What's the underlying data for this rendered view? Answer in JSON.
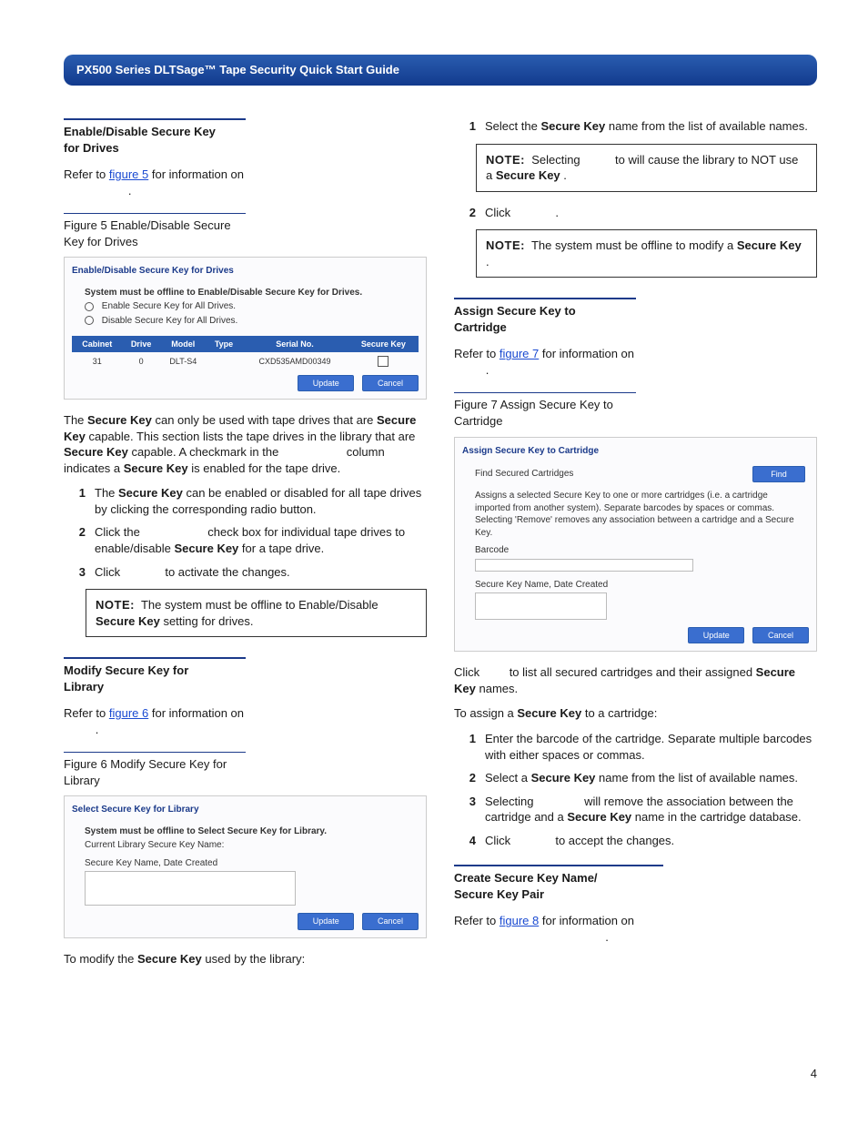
{
  "banner": "PX500 Series DLTSage™ Tape Security Quick Start Guide",
  "page_number": "4",
  "L": {
    "s1_title_a": "Enable/Disable Secure Key",
    "s1_title_b": "for Drives",
    "s1_para": "Refer to ",
    "s1_link": "figure 5",
    "s1_para2": " for information on",
    "s1_para_end": ".",
    "fig5_cap_a": "Figure 5  Enable/Disable Secure",
    "fig5_cap_b": "Key for Drives",
    "fig5": {
      "panel_title": "Enable/Disable Secure Key for Drives",
      "warn": "System must be offline to Enable/Disable Secure Key for Drives.",
      "radio1": "Enable Secure Key for All Drives.",
      "radio2": "Disable Secure Key for All Drives.",
      "th": [
        "Cabinet",
        "Drive",
        "Model",
        "Type",
        "Serial No.",
        "Secure Key"
      ],
      "row": [
        "31",
        "0",
        "DLT-S4",
        "",
        "CXD535AMD00349",
        ""
      ],
      "btn_update": "Update",
      "btn_cancel": "Cancel"
    },
    "p1a": "The ",
    "p1b": "Secure Key",
    "p1c": " can only be used with tape drives that are ",
    "p1d": "Secure Key",
    "p1e": " capable. This section lists the tape drives in the library that are ",
    "p1f": "Secure Key",
    "p1g": " capable. A checkmark in the",
    "p1h": "column indicates a ",
    "p1i": "Secure Key",
    "p1j": " is enabled for the tape drive.",
    "li1a": "The ",
    "li1b": "Secure Key",
    "li1c": " can be enabled or disabled for all tape drives by clicking the corresponding radio button.",
    "li2a": "Click the ",
    "li2b": "check box for individual tape drives to enable/disable ",
    "li2c": "Secure Key",
    "li2d": " for a tape drive.",
    "li3a": "Click ",
    "li3b": "to activate the changes.",
    "note1_l": "NOTE:",
    "note1a": "The system must be offline to Enable/Disable ",
    "note1b": "Secure Key",
    "note1c": " setting for drives.",
    "s2_title_a": "Modify Secure Key for",
    "s2_title_b": "Library",
    "s2_para": "Refer to ",
    "s2_link": "figure 6",
    "s2_para2": " for information on",
    "s2_para_end": ".",
    "fig6_cap_a": "Figure 6  Modify Secure Key for",
    "fig6_cap_b": "Library",
    "fig6": {
      "panel_title": "Select Secure Key for Library",
      "warn": "System must be offline to Select Secure Key for Library.",
      "curr": "Current Library Secure Key Name:",
      "lbl": "Secure Key Name, Date Created",
      "btn_update": "Update",
      "btn_cancel": "Cancel"
    },
    "p2a": "To modify the ",
    "p2b": "Secure Key",
    "p2c": " used by the library:"
  },
  "R": {
    "li1a": "Select the ",
    "li1b": "Secure Key",
    "li1c": " name from the list of available names.",
    "noteA_l": "NOTE:",
    "noteA_a": "Selecting ",
    "noteA_gap": "to will cause the library to NOT use a ",
    "noteA_b": "Secure Key",
    "noteA_c": ".",
    "li2a": "Click ",
    "li2b": ".",
    "noteB_l": "NOTE:",
    "noteB_a": "The system must be offline to modify a ",
    "noteB_b": "Secure Key",
    "noteB_c": ".",
    "s3_title_a": "Assign Secure Key to",
    "s3_title_b": "Cartridge",
    "s3_para": "Refer to ",
    "s3_link": "figure 7",
    "s3_para2": " for information on",
    "s3_para_end": ".",
    "fig7_cap_a": "Figure 7  Assign Secure Key to",
    "fig7_cap_b": "Cartridge",
    "fig7": {
      "panel_title": "Assign Secure Key to Cartridge",
      "find_lbl": "Find Secured Cartridges",
      "find_btn": "Find",
      "desc": "Assigns a selected Secure Key to one or more cartridges (i.e. a cartridge imported from another system). Separate barcodes by spaces or commas. Selecting 'Remove' removes any association between a cartridge and a Secure Key.",
      "barcode_lbl": "Barcode",
      "sk_lbl": "Secure Key Name, Date Created",
      "btn_update": "Update",
      "btn_cancel": "Cancel"
    },
    "p1a": "Click ",
    "p1b": " to list all secured cartridges and their assigned ",
    "p1c": "Secure Key",
    "p1d": " names.",
    "p2a": "To assign a ",
    "p2b": "Secure Key",
    "p2c": " to a cartridge:",
    "li_c1": "Enter the barcode of the cartridge. Separate multiple barcodes with either spaces or commas.",
    "li_c2a": "Select a ",
    "li_c2b": "Secure Key",
    "li_c2c": " name from the list of available names.",
    "li_c3a": "Selecting ",
    "li_c3b": "will remove the association between the cartridge and a ",
    "li_c3c": "Secure Key",
    "li_c3d": " name in the cartridge database.",
    "li_c4a": "Click ",
    "li_c4b": "to accept the changes.",
    "s4_title_a": "Create Secure Key Name/",
    "s4_title_b": "Secure Key Pair",
    "s4_para": "Refer to ",
    "s4_link": "figure 8",
    "s4_para2": " for information on",
    "s4_para_end": "."
  }
}
